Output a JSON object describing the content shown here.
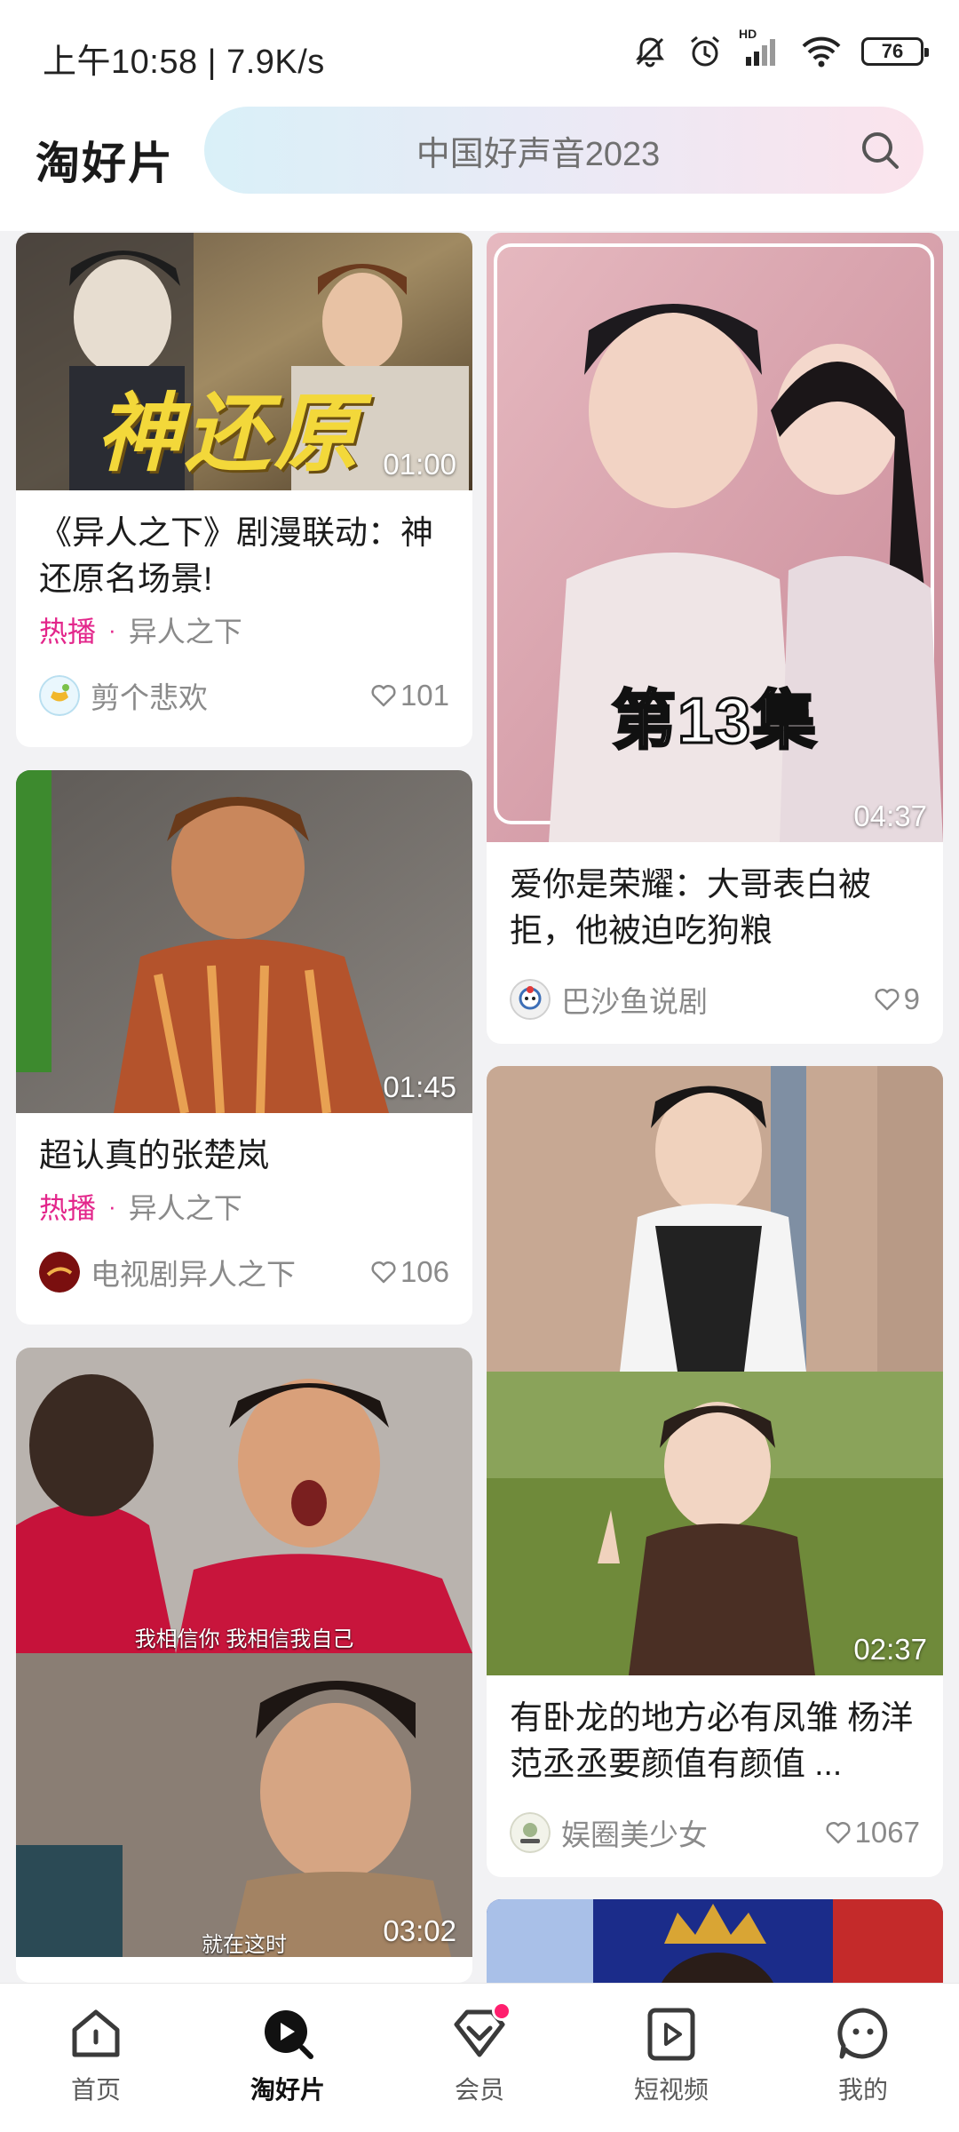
{
  "status_bar": {
    "time": "上午10:58 | 7.9K/s",
    "network": "HD",
    "battery": "76",
    "icons": [
      "mute-bell-icon",
      "alarm-icon",
      "signal-icon",
      "wifi-icon",
      "battery-icon"
    ]
  },
  "header": {
    "brand": "淘好片",
    "search_placeholder": "中国好声音2023"
  },
  "feed": {
    "left": [
      {
        "duration": "01:00",
        "overlay": "神还原",
        "title": "《异人之下》剧漫联动：神还原名场景!",
        "tag": "热播",
        "series": "异人之下",
        "author": "剪个悲欢",
        "likes": "101"
      },
      {
        "duration": "01:45",
        "title": "超认真的张楚岚",
        "tag": "热播",
        "series": "异人之下",
        "author": "电视剧异人之下",
        "likes": "106"
      },
      {
        "duration": "03:02",
        "subtitle_top": "我相信你 我相信我自己",
        "subtitle_bottom": "就在这时"
      }
    ],
    "right": [
      {
        "duration": "04:37",
        "overlay": "第13集",
        "title": "爱你是荣耀：大哥表白被拒，他被迫吃狗粮",
        "author": "巴沙鱼说剧",
        "likes": "9"
      },
      {
        "duration": "02:37",
        "title": "有卧龙的地方必有凤雏 杨洋范丞丞要颜值有颜值 ...",
        "author": "娱圈美少女",
        "likes": "1067"
      }
    ]
  },
  "bottom_nav": [
    {
      "label": "首页",
      "icon": "home-icon"
    },
    {
      "label": "淘好片",
      "icon": "discover-play-icon",
      "active": true
    },
    {
      "label": "会员",
      "icon": "vip-diamond-icon",
      "badge": true
    },
    {
      "label": "短视频",
      "icon": "short-video-icon"
    },
    {
      "label": "我的",
      "icon": "profile-chat-icon"
    }
  ],
  "colors": {
    "accent_pink": "#e3268b",
    "badge_red": "#ff1f6e"
  }
}
